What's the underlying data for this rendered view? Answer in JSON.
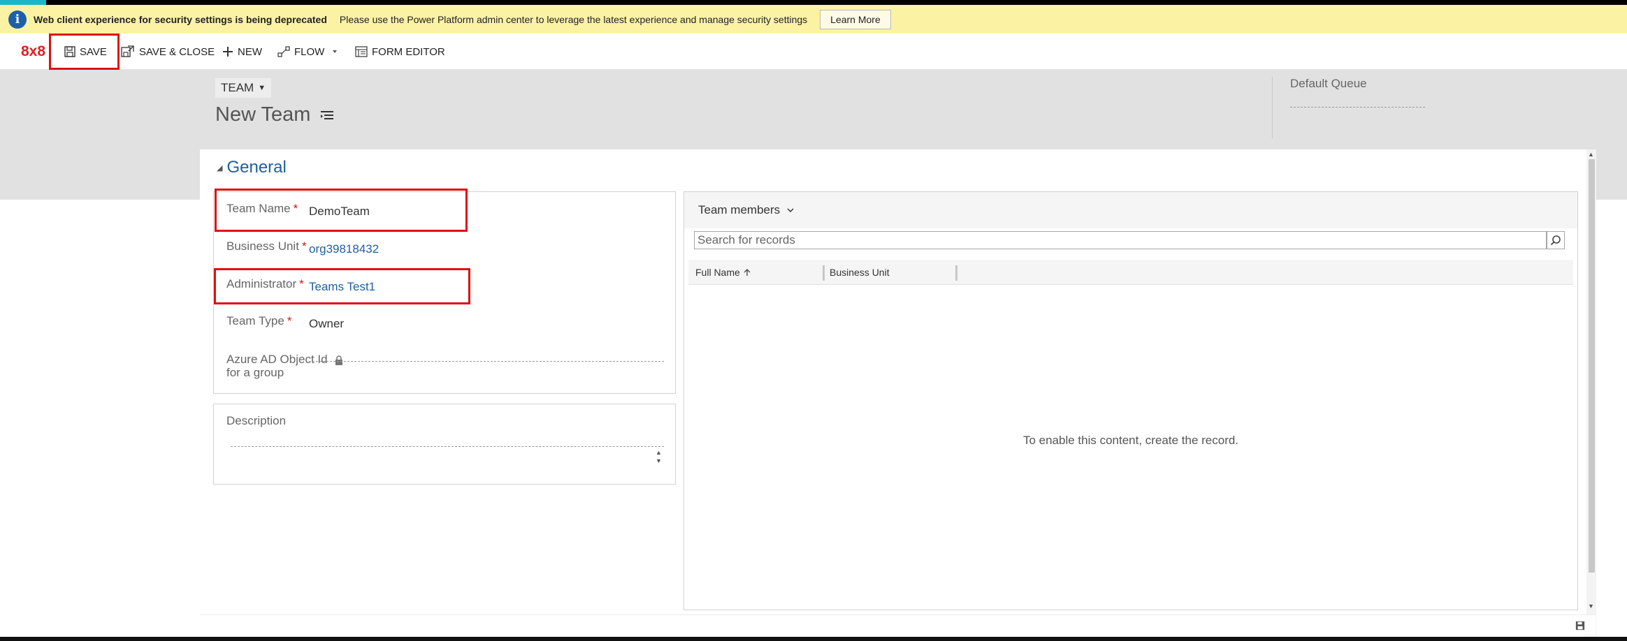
{
  "banner": {
    "title": "Web client experience for security settings is being deprecated",
    "message": "Please use the Power Platform admin center to leverage the latest experience and manage security settings",
    "learn_more": "Learn More"
  },
  "toolbar": {
    "logo": "8x8",
    "save": "SAVE",
    "save_close": "SAVE & CLOSE",
    "new": "NEW",
    "flow": "FLOW",
    "form_editor": "FORM EDITOR"
  },
  "header": {
    "entity": "TEAM",
    "title": "New Team",
    "default_queue_label": "Default Queue"
  },
  "section": {
    "title": "General"
  },
  "fields": {
    "team_name_label": "Team Name",
    "team_name_value": "DemoTeam",
    "business_unit_label": "Business Unit",
    "business_unit_value": "org39818432",
    "administrator_label": "Administrator",
    "administrator_value": "Teams Test1",
    "team_type_label": "Team Type",
    "team_type_value": "Owner",
    "azure_label_line1": "Azure AD Object Id",
    "azure_label_line2": "for a group",
    "required_mark": "*"
  },
  "description": {
    "label": "Description"
  },
  "subgrid": {
    "title": "Team members",
    "search_placeholder": "Search for records",
    "columns": [
      "Full Name",
      "Business Unit"
    ],
    "empty_message": "To enable this content, create the record."
  },
  "colors": {
    "accent": "#1ab8c7",
    "highlight": "#dd1111",
    "link": "#1f5fa0",
    "banner": "#fbf3a3"
  }
}
